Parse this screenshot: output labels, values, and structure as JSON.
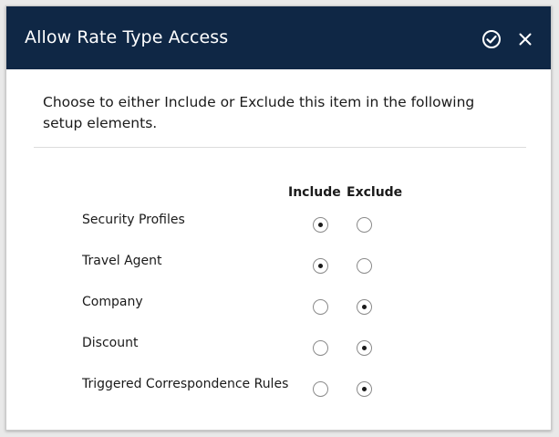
{
  "dialog": {
    "title": "Allow Rate Type Access",
    "confirm_icon": "check-circle-icon",
    "close_icon": "close-icon"
  },
  "intro": "Choose to either Include or Exclude this item in the following setup elements.",
  "columns": {
    "include": "Include",
    "exclude": "Exclude"
  },
  "rows": [
    {
      "label": "Security Profiles",
      "selection": "include"
    },
    {
      "label": "Travel Agent",
      "selection": "include"
    },
    {
      "label": "Company",
      "selection": "exclude"
    },
    {
      "label": "Discount",
      "selection": "exclude"
    },
    {
      "label": "Triggered Correspondence Rules",
      "selection": "exclude"
    }
  ],
  "colors": {
    "header_bg": "#0f2745",
    "header_text": "#ffffff"
  }
}
